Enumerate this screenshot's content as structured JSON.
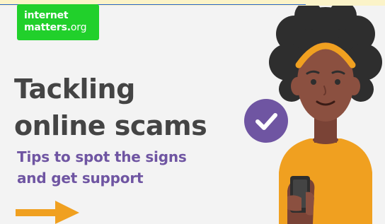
{
  "logo": {
    "line1": "internet",
    "line2_main": "matters",
    "line2_dot": ".",
    "line2_suffix": "org"
  },
  "headline": {
    "line1": "Tackling",
    "line2": "online scams"
  },
  "subheadline": {
    "line1": "Tips to spot the signs",
    "line2": "and get support"
  },
  "colors": {
    "brand_green": "#21d02b",
    "headline_text": "#444444",
    "subheadline_text": "#6f55a2",
    "check_circle": "#6f55a2",
    "arrow": "#f0a020",
    "shirt": "#f0a020",
    "headband": "#f0a020",
    "hair": "#2e2e2e",
    "skin": "#8b5040"
  },
  "icons": [
    "check-circle-icon",
    "right-arrow-icon",
    "woman-with-phone-illustration"
  ]
}
